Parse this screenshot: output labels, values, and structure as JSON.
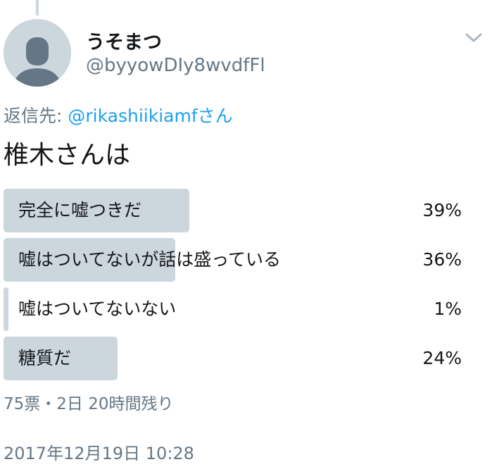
{
  "user": {
    "display_name": "うそまつ",
    "handle": "@byyowDIy8wvdfFl"
  },
  "reply": {
    "prefix": "返信先: ",
    "mention": "@rikashiikiamfさん"
  },
  "tweet": {
    "text": "椎木さんは"
  },
  "poll": {
    "options": [
      {
        "label": "完全に嘘つきだ",
        "percent_text": "39%",
        "percent": 39
      },
      {
        "label": "嘘はついてないが話は盛っている",
        "percent_text": "36%",
        "percent": 36
      },
      {
        "label": "嘘はついてないない",
        "percent_text": "1%",
        "percent": 1
      },
      {
        "label": "糖質だ",
        "percent_text": "24%",
        "percent": 24
      }
    ],
    "meta": "75票・2日 20時間残り"
  },
  "timestamp": "2017年12月19日 10:28",
  "colors": {
    "bar": "#ccd6dd",
    "mention": "#1da1f2",
    "secondary_text": "#657786",
    "primary_text": "#14171a"
  },
  "icons": {
    "avatar": "default-profile-silhouette-icon",
    "caret": "chevron-down-icon"
  }
}
